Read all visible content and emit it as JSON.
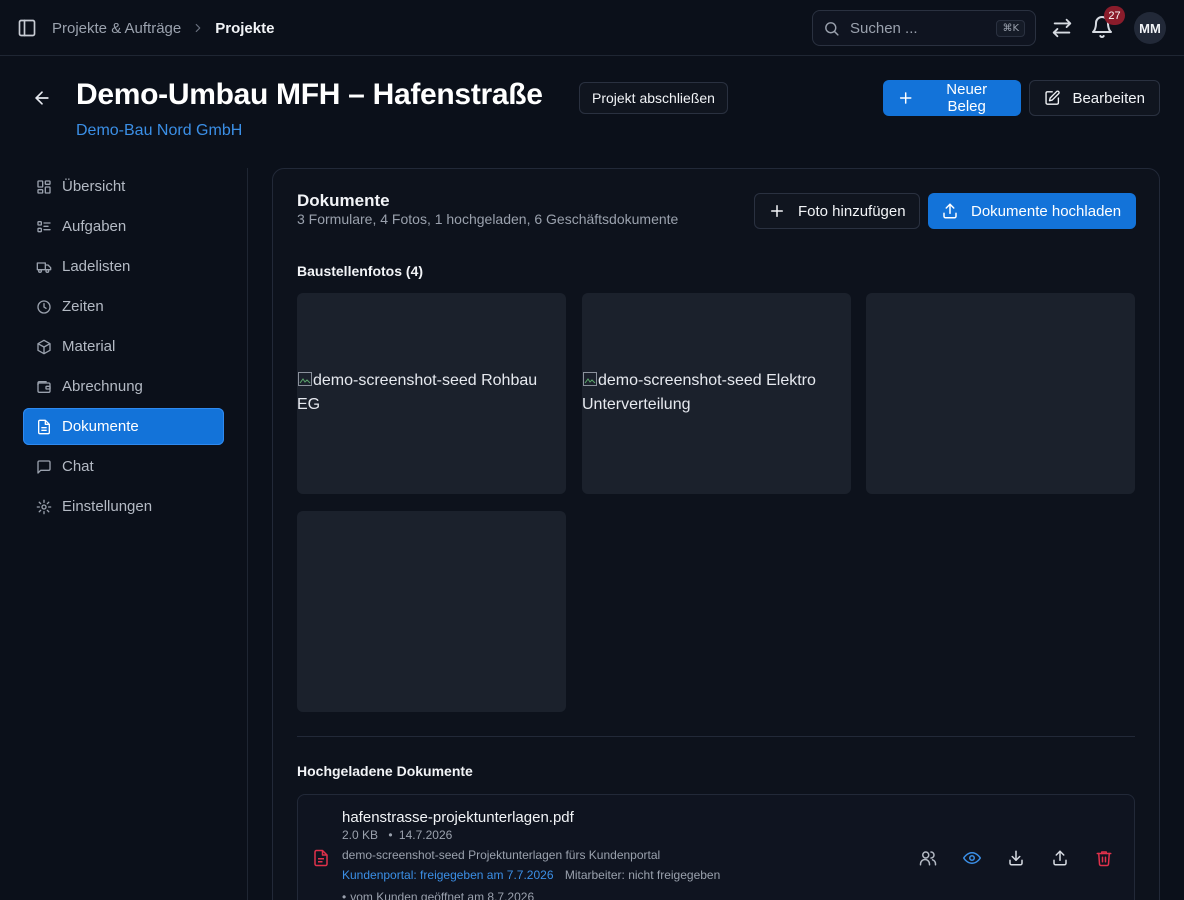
{
  "topbar": {
    "breadcrumb": [
      "Projekte & Aufträge",
      "Projekte"
    ],
    "search_placeholder": "Suchen ...",
    "search_shortcut": "⌘K",
    "notification_count": "27",
    "avatar_initials": "MM"
  },
  "header": {
    "title": "Demo-Umbau MFH – Hafenstraße",
    "close_project_label": "Projekt abschließen",
    "customer": "Demo-Bau Nord GmbH",
    "new_doc_label": "Neuer Beleg",
    "edit_label": "Bearbeiten"
  },
  "nav": {
    "items": [
      {
        "label": "Übersicht",
        "icon": "dashboard-icon"
      },
      {
        "label": "Aufgaben",
        "icon": "list-checks-icon"
      },
      {
        "label": "Ladelisten",
        "icon": "truck-icon"
      },
      {
        "label": "Zeiten",
        "icon": "clock-icon"
      },
      {
        "label": "Material",
        "icon": "package-icon"
      },
      {
        "label": "Abrechnung",
        "icon": "wallet-icon"
      },
      {
        "label": "Dokumente",
        "icon": "document-icon"
      },
      {
        "label": "Chat",
        "icon": "chat-icon"
      },
      {
        "label": "Einstellungen",
        "icon": "gear-icon"
      }
    ],
    "active": "Dokumente"
  },
  "documents": {
    "title": "Dokumente",
    "subtitle": "3 Formulare, 4 Fotos, 1 hochgeladen, 6 Geschäftsdokumente",
    "add_photo_label": "Foto hinzufügen",
    "upload_label": "Dokumente hochladen",
    "photos_title": "Baustellenfotos (4)",
    "photos": [
      {
        "alt": "demo-screenshot-seed Rohbau EG"
      },
      {
        "alt": "demo-screenshot-seed Elektro Unterverteilung"
      },
      {
        "alt": ""
      },
      {
        "alt": ""
      }
    ],
    "uploaded_title": "Hochgeladene Dokumente",
    "files": [
      {
        "name": "hafenstrasse-projektunterlagen.pdf",
        "size": "2.0 KB",
        "date": "14.7.2026",
        "description": "demo-screenshot-seed Projektunterlagen fürs Kundenportal",
        "portal_status": "Kundenportal: freigegeben am 7.7.2026",
        "staff_status": "Mitarbeiter: nicht freigegeben",
        "opened": "vom Kunden geöffnet am 8.7.2026"
      }
    ]
  },
  "colors": {
    "accent": "#1373d9",
    "link": "#3b8fe6",
    "danger": "#e0314b",
    "badge": "#8a1c2b",
    "background": "#0b101a"
  }
}
